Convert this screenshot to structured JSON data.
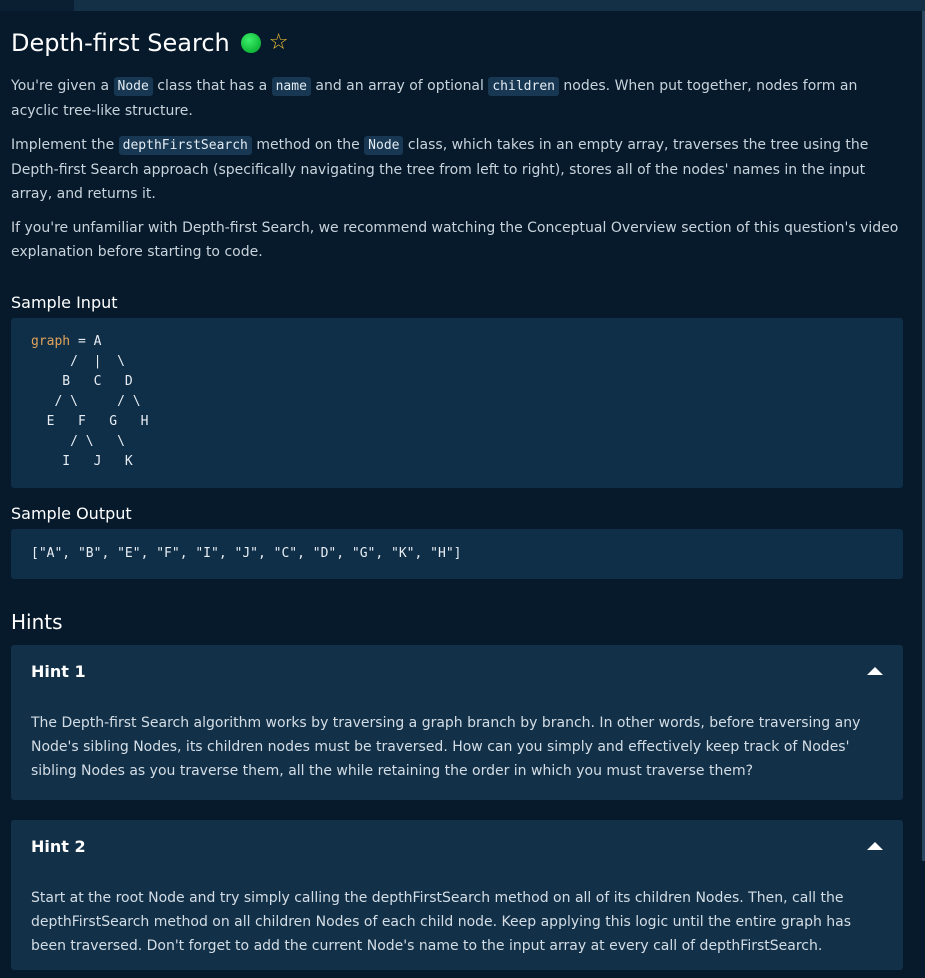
{
  "problem": {
    "title": "Depth-first Search",
    "status": "completed",
    "favorite": false
  },
  "description": {
    "p1": {
      "t1": "You're given a ",
      "c1": "Node",
      "t2": " class that has a ",
      "c2": "name",
      "t3": " and an array of optional ",
      "c3": "children",
      "t4": " nodes. When put together, nodes form an acyclic tree-like structure."
    },
    "p2": {
      "t1": "Implement the ",
      "c1": "depthFirstSearch",
      "t2": " method on the ",
      "c2": "Node",
      "t3": " class, which takes in an empty array, traverses the tree using the Depth-first Search approach (specifically navigating the tree from left to right), stores all of the nodes' names in the input array, and returns it."
    },
    "p3": "If you're unfamiliar with Depth-first Search, we recommend watching the Conceptual Overview section of this question's video explanation before starting to code."
  },
  "sample_input": {
    "label": "Sample Input",
    "var_name": "graph",
    "first_line_rest": " = A",
    "tree_lines": "     /  |  \\\n    B   C   D\n   / \\     / \\\n  E   F   G   H\n     / \\   \\\n    I   J   K"
  },
  "sample_output": {
    "label": "Sample Output",
    "value": "[\"A\", \"B\", \"E\", \"F\", \"I\", \"J\", \"C\", \"D\", \"G\", \"K\", \"H\"]"
  },
  "hints": {
    "title": "Hints",
    "items": [
      {
        "title": "Hint 1",
        "body": "The Depth-first Search algorithm works by traversing a graph branch by branch. In other words, before traversing any Node's sibling Nodes, its children nodes must be traversed. How can you simply and effectively keep track of Nodes' sibling Nodes as you traverse them, all the while retaining the order in which you must traverse them?"
      },
      {
        "title": "Hint 2",
        "body": "Start at the root Node and try simply calling the depthFirstSearch method on all of its children Nodes. Then, call the depthFirstSearch method on all children Nodes of each child node. Keep applying this logic until the entire graph has been traversed. Don't forget to add the current Node's name to the input array at every call of depthFirstSearch."
      }
    ]
  },
  "colors": {
    "background": "#061a2b",
    "card": "#123149",
    "status_green": "#10b83a",
    "star": "#f1c232",
    "keyword": "#e0a45a"
  },
  "icons": [
    "status-dot-icon",
    "star-outline-icon",
    "caret-up-icon"
  ]
}
